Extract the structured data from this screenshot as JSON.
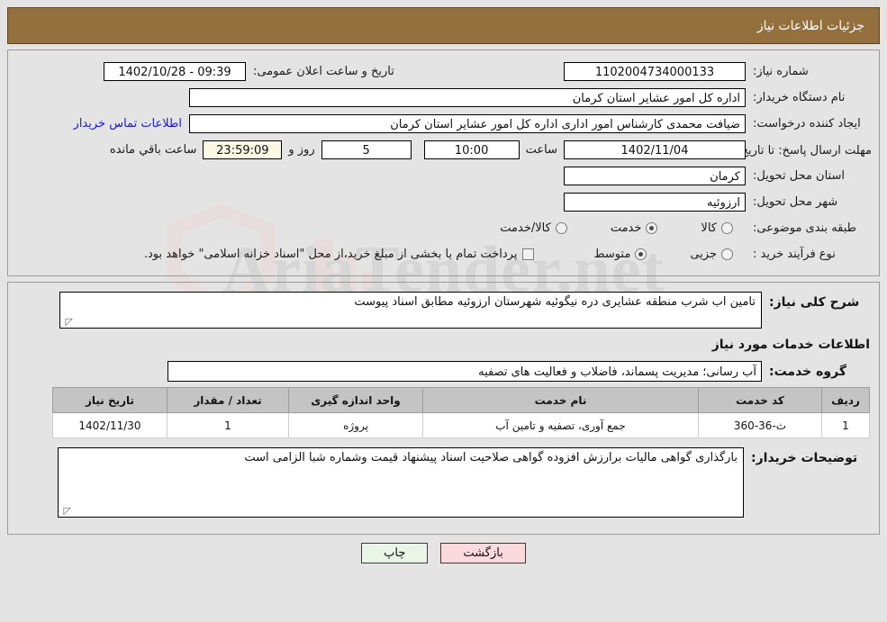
{
  "header": {
    "title": "جزئیات اطلاعات نیاز"
  },
  "top_form": {
    "need_number": {
      "label": "شماره نیاز:",
      "value": "1102004734000133"
    },
    "announce_datetime": {
      "label": "تاریخ و ساعت اعلان عمومی:",
      "value": "09:39 - 1402/10/28"
    },
    "buyer_org": {
      "label": "نام دستگاه خریدار:",
      "value": "اداره کل امور عشایر استان کرمان"
    },
    "creator": {
      "label": "ایجاد کننده درخواست:",
      "value": "ضیافت محمدی کارشناس امور اداری اداره کل امور عشایر استان کرمان"
    },
    "buyer_contact_link": "اطلاعات تماس خریدار",
    "deadline": {
      "label": "مهلت ارسال پاسخ: تا تاریخ:",
      "date": "1402/11/04",
      "time_label": "ساعت",
      "time": "10:00",
      "days": "5",
      "days_label": "روز و",
      "countdown": "23:59:09",
      "countdown_label": "ساعت باقي مانده"
    },
    "delivery_province": {
      "label": "استان محل تحویل:",
      "value": "کرمان"
    },
    "delivery_city": {
      "label": "شهر محل تحویل:",
      "value": "ارزوئیه"
    },
    "category": {
      "label": "طبقه بندی موضوعی:",
      "options": [
        {
          "text": "کالا",
          "selected": false
        },
        {
          "text": "خدمت",
          "selected": true
        },
        {
          "text": "کالا/خدمت",
          "selected": false
        }
      ]
    },
    "purchase_process": {
      "label": "نوع فرآیند خرید :",
      "options": [
        {
          "text": "جزیی",
          "selected": false
        },
        {
          "text": "متوسط",
          "selected": true
        }
      ]
    },
    "treasury_note": {
      "checked": false,
      "text": "پرداخت تمام یا بخشی از مبلغ خرید،از محل \"اسناد خزانه اسلامی\" خواهد بود."
    }
  },
  "mid": {
    "general_description": {
      "label": "شرح کلی نیاز:",
      "value": "تامین اب شرب منطقه عشایری دره نیگوئیه شهرستان ارزوئیه مطابق اسناد پیوست"
    },
    "section_title": "اطلاعات خدمات مورد نیاز",
    "service_group": {
      "label": "گروه خدمت:",
      "value": "آب رسانی؛ مدیریت پسماند، فاضلاب و فعالیت های تصفیه"
    },
    "table": {
      "columns": [
        "ردیف",
        "کد خدمت",
        "نام خدمت",
        "واحد اندازه گیری",
        "تعداد / مقدار",
        "تاریخ نیاز"
      ],
      "rows": [
        [
          "1",
          "ث-36-360",
          "جمع آوری، تصفیه و تامین آب",
          "پروژه",
          "1",
          "1402/11/30"
        ]
      ]
    },
    "buyer_notes": {
      "label": "توضیحات خریدار:",
      "value": "بارگذاری گواهی مالیات برارزش افزوده  گواهی صلاحیت اسناد پیشنهاد قیمت وشماره شبا الزامی است"
    }
  },
  "footer": {
    "print_button": "چاپ",
    "back_button": "بازگشت"
  },
  "watermark": {
    "text": "AriaTender.net"
  },
  "colors": {
    "header_bg": "#93703e",
    "link": "#1818d8",
    "print_btn": "#e9f6e7",
    "back_btn": "#fadadd",
    "table_header": "#c4c4c4"
  }
}
